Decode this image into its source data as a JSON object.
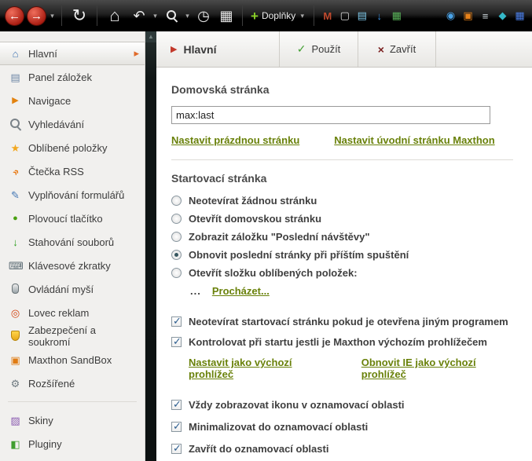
{
  "icons": {
    "back": "←",
    "forward": "→",
    "caret": "▾",
    "refresh": "↻",
    "home": "⌂",
    "undo": "↶",
    "history": "◷",
    "tabs": "▦",
    "plus": "+",
    "title_arrow": "▶",
    "apply_check": "✓",
    "close_x": "×",
    "selected_arrow": "▸",
    "browse_ellipsis": "...",
    "scroll_up": "▲"
  },
  "toolbar": {
    "addons_label": "Doplňky",
    "addon_icons": [
      {
        "glyph": "M"
      },
      {
        "glyph": "▢"
      },
      {
        "glyph": "▤"
      },
      {
        "glyph": "↓"
      },
      {
        "glyph": "▦"
      }
    ],
    "right_icons": [
      {
        "glyph": "◉"
      },
      {
        "glyph": "▣"
      },
      {
        "glyph": "≡"
      },
      {
        "glyph": "◆"
      },
      {
        "glyph": "▦"
      }
    ]
  },
  "sidebar": {
    "items": [
      {
        "label": "Hlavní",
        "glyph": "⌂",
        "selected": true
      },
      {
        "label": "Panel záložek",
        "glyph": "▤"
      },
      {
        "label": "Navigace",
        "glyph": "▶"
      },
      {
        "label": "Vyhledávání",
        "glyph": ""
      },
      {
        "label": "Oblíbené položky",
        "glyph": "★"
      },
      {
        "label": "Čtečka RSS",
        "glyph": "»"
      },
      {
        "label": "Vyplňování formulářů",
        "glyph": "✎"
      },
      {
        "label": "Plovoucí tlačítko",
        "glyph": "●"
      },
      {
        "label": "Stahování souborů",
        "glyph": "↓"
      },
      {
        "label": "Klávesové zkratky",
        "glyph": "⌨"
      },
      {
        "label": "Ovládání myší",
        "glyph": ""
      },
      {
        "label": "Lovec reklam",
        "glyph": "◎"
      },
      {
        "label": "Zabezpečení a soukromí",
        "glyph": ""
      },
      {
        "label": "Maxthon SandBox",
        "glyph": "▣"
      },
      {
        "label": "Rozšířené",
        "glyph": "⚙"
      },
      {
        "label": "Skiny",
        "glyph": "▨"
      },
      {
        "label": "Pluginy",
        "glyph": "◧"
      }
    ]
  },
  "header": {
    "title": "Hlavní",
    "apply_label": "Použít",
    "close_label": "Zavřít"
  },
  "main": {
    "homepage": {
      "heading": "Domovská stránka",
      "input_value": "max:last",
      "link_blank": "Nastavit prázdnou stránku",
      "link_maxthon": "Nastavit úvodní stránku Maxthon"
    },
    "startup": {
      "heading": "Startovací stránka",
      "options": [
        {
          "label": "Neotevírat žádnou stránku",
          "selected": false
        },
        {
          "label": "Otevřít domovskou stránku",
          "selected": false
        },
        {
          "label": "Zobrazit záložku \"Poslední návštěvy\"",
          "selected": false
        },
        {
          "label": "Obnovit poslední stránky při příštím spuštění",
          "selected": true
        },
        {
          "label": "Otevřít složku oblíbených položek:",
          "selected": false
        }
      ],
      "browse_label": "Procházet..."
    },
    "startup_checkboxes": [
      {
        "label": "Neotevírat startovací stránku pokud je otevřena jiným programem",
        "checked": true
      },
      {
        "label": "Kontrolovat při startu jestli je Maxthon výchozím prohlížečem",
        "checked": true
      }
    ],
    "default_browser_links": {
      "set_default": "Nastavit jako výchozí prohlížeč",
      "restore_ie": "Obnovit IE jako výchozí prohlížeč"
    },
    "tray_checkboxes": [
      {
        "label": "Vždy zobrazovat ikonu v oznamovací oblasti",
        "checked": true
      },
      {
        "label": "Minimalizovat do oznamovací oblasti",
        "checked": true
      },
      {
        "label": "Zavřít do oznamovací oblasti",
        "checked": true
      }
    ]
  },
  "colors": {
    "link_green": "#69810a",
    "accent_red": "#c2392b",
    "check_blue": "#2c5d8f"
  }
}
